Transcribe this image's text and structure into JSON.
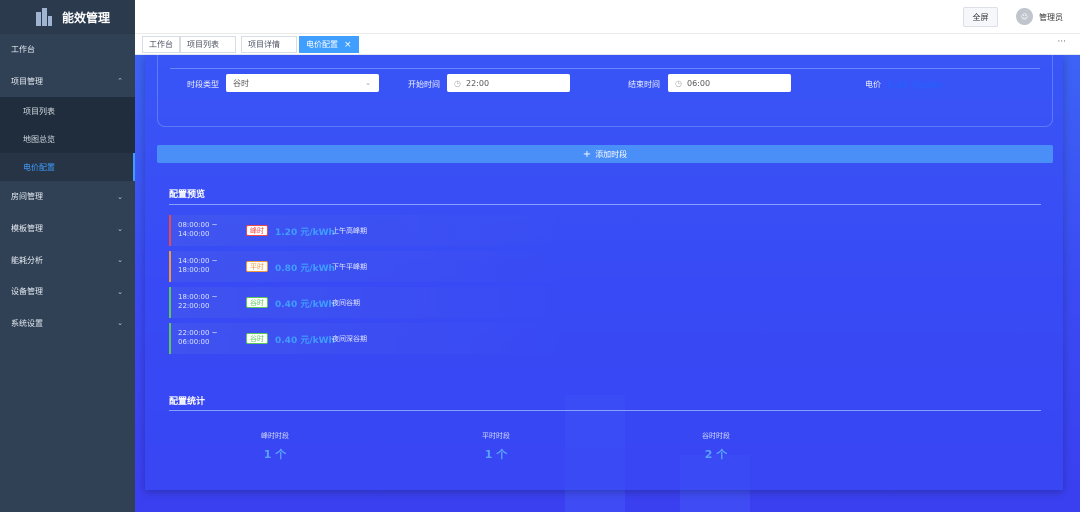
{
  "app": {
    "title": "能效管理"
  },
  "sidebar": {
    "items": [
      {
        "label": "工作台",
        "chevron": false
      },
      {
        "label": "项目管理",
        "chevron": "up",
        "children": [
          {
            "label": "项目列表"
          },
          {
            "label": "地图总览"
          },
          {
            "label": "电价配置",
            "active": true
          }
        ]
      },
      {
        "label": "房间管理",
        "chevron": "down"
      },
      {
        "label": "模板管理",
        "chevron": "down"
      },
      {
        "label": "能耗分析",
        "chevron": "down"
      },
      {
        "label": "设备管理",
        "chevron": "down"
      },
      {
        "label": "系统设置",
        "chevron": "down"
      }
    ]
  },
  "header": {
    "fullscreen_label": "全屏",
    "username": "管理员"
  },
  "tabs": [
    {
      "label": "工作台"
    },
    {
      "label": "项目列表"
    },
    {
      "label": "项目详情"
    },
    {
      "label": "电价配置",
      "active": true
    }
  ],
  "segment_form": {
    "type_label": "时段类型",
    "type_value": "谷时",
    "start_label": "开始时间",
    "start_value": "22:00",
    "end_label": "结束时间",
    "end_value": "06:00",
    "price_label": "电价",
    "price_value": "0.40 元/kWh"
  },
  "add_button_label": "添加时段",
  "preview": {
    "title": "配置预览",
    "rows": [
      {
        "time_start": "08:00:00 ~",
        "time_end": "14:00:00",
        "badge": "峰时",
        "price": "1.20 元/kWh",
        "desc": "上午高峰期",
        "color": "#f04848"
      },
      {
        "time_start": "14:00:00 ~",
        "time_end": "18:00:00",
        "badge": "平时",
        "price": "0.80 元/kWh",
        "desc": "下午平峰期",
        "color": "#f09a3c"
      },
      {
        "time_start": "18:00:00 ~",
        "time_end": "22:00:00",
        "badge": "谷时",
        "price": "0.40 元/kWh",
        "desc": "夜间谷期",
        "color": "#5cc85c"
      },
      {
        "time_start": "22:00:00 ~",
        "time_end": "06:00:00",
        "badge": "谷时",
        "price": "0.40 元/kWh",
        "desc": "夜间深谷期",
        "color": "#5cc85c"
      }
    ]
  },
  "stats": {
    "title": "配置统计",
    "items": [
      {
        "label": "峰时时段",
        "value": "1 个"
      },
      {
        "label": "平时时段",
        "value": "1 个"
      },
      {
        "label": "谷时时段",
        "value": "2 个"
      }
    ]
  },
  "colors": {
    "accent": "#409eff",
    "sidebar_bg": "#304156",
    "content_bg": "#3b4bf3"
  }
}
